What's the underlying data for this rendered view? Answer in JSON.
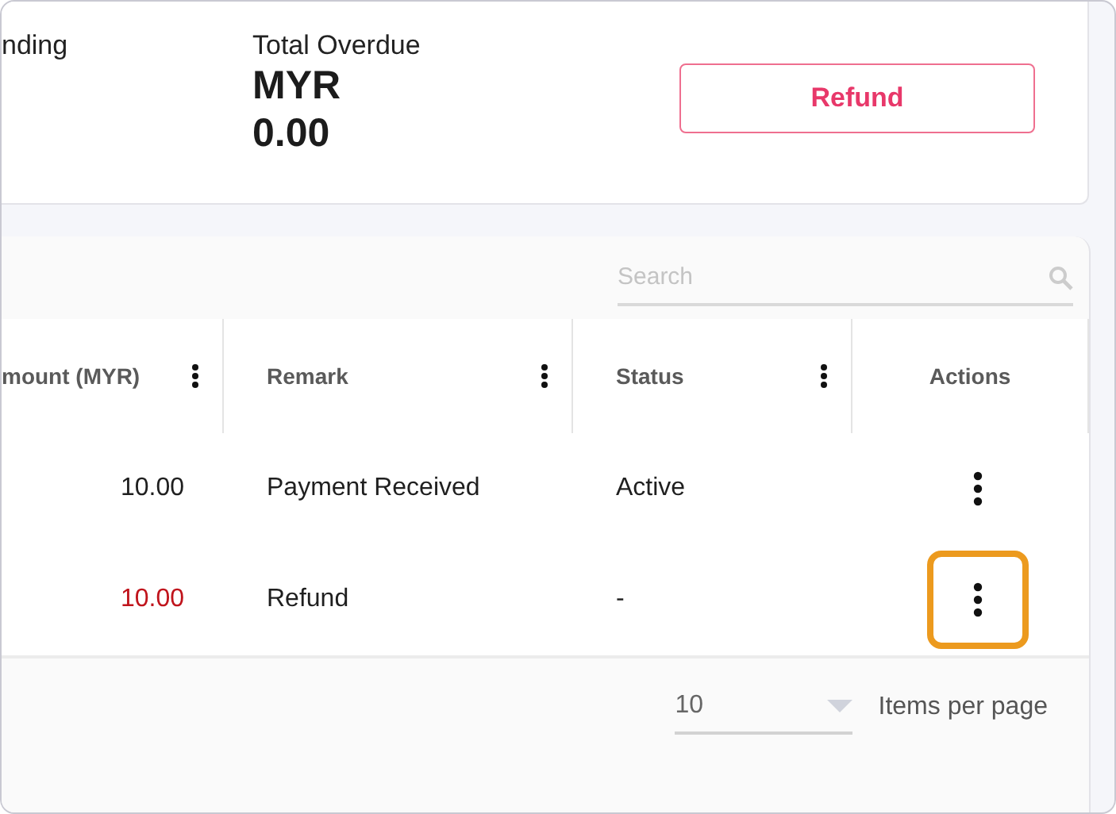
{
  "summary": {
    "outstanding_label": "nding",
    "overdue_label": "Total Overdue",
    "overdue_currency": "MYR",
    "overdue_value": "0.00",
    "refund_button": "Refund"
  },
  "search": {
    "placeholder": "Search"
  },
  "table": {
    "columns": [
      {
        "label": "mount (MYR)",
        "menu": true
      },
      {
        "label": "Remark",
        "menu": true
      },
      {
        "label": "Status",
        "menu": true
      },
      {
        "label": "Actions",
        "menu": false
      }
    ],
    "rows": [
      {
        "amount": "10.00",
        "negative": false,
        "remark": "Payment Received",
        "status": "Active",
        "highlighted": false
      },
      {
        "amount": "10.00",
        "negative": true,
        "remark": "Refund",
        "status": "-",
        "highlighted": true
      }
    ]
  },
  "pagination": {
    "page_size": "10",
    "label": "Items per page"
  }
}
